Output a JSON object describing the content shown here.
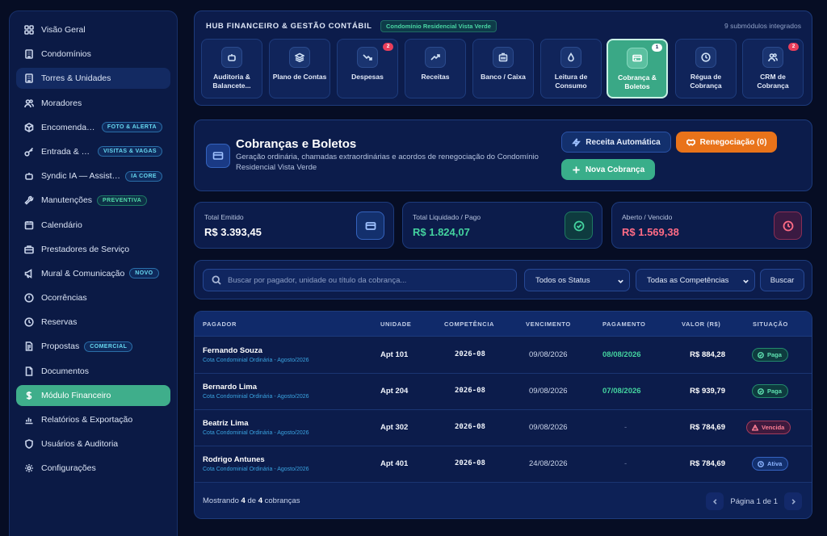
{
  "sidebar": {
    "items": [
      {
        "label": "Visão Geral",
        "icon": "grid-icon"
      },
      {
        "label": "Condomínios",
        "icon": "building-icon"
      },
      {
        "label": "Torres & Unidades",
        "icon": "building-icon"
      },
      {
        "label": "Moradores",
        "icon": "users-icon"
      },
      {
        "label": "Encomendas &...",
        "icon": "package-icon",
        "badge": "FOTO & ALERTA"
      },
      {
        "label": "Entrada & Gar...",
        "icon": "key-icon",
        "badge": "VISITAS & VAGAS"
      },
      {
        "label": "Syndic IA — Assistente",
        "icon": "bot-icon",
        "badge": "IA CORE"
      },
      {
        "label": "Manutenções",
        "icon": "wrench-icon",
        "badge": "PREVENTIVA"
      },
      {
        "label": "Calendário",
        "icon": "calendar-icon"
      },
      {
        "label": "Prestadores de Serviço",
        "icon": "briefcase-icon"
      },
      {
        "label": "Mural & Comunicação",
        "icon": "megaphone-icon",
        "badge": "NOVO"
      },
      {
        "label": "Ocorrências",
        "icon": "alert-circle-icon"
      },
      {
        "label": "Reservas",
        "icon": "clock-icon"
      },
      {
        "label": "Propostas",
        "icon": "document-icon",
        "badge": "COMERCIAL"
      },
      {
        "label": "Documentos",
        "icon": "file-icon"
      },
      {
        "label": "Módulo Financeiro",
        "icon": "dollar-icon"
      },
      {
        "label": "Relatórios & Exportação",
        "icon": "chart-icon"
      },
      {
        "label": "Usuários & Auditoria",
        "icon": "shield-icon"
      },
      {
        "label": "Configurações",
        "icon": "gear-icon"
      }
    ]
  },
  "hub": {
    "title": "HUB FINANCEIRO & GESTÃO CONTÁBIL",
    "condominium": "Condomínio Residencial Vista Verde",
    "count": "9 submódulos integrados",
    "modules": [
      {
        "label": "Auditoria & Balancete...",
        "icon": "robot-icon"
      },
      {
        "label": "Plano de Contas",
        "icon": "layers-icon"
      },
      {
        "label": "Despesas",
        "icon": "trending-down-icon",
        "badge": "2"
      },
      {
        "label": "Receitas",
        "icon": "trending-up-icon"
      },
      {
        "label": "Banco / Caixa",
        "icon": "bank-icon"
      },
      {
        "label": "Leitura de Consumo",
        "icon": "droplet-icon"
      },
      {
        "label": "Cobrança & Boletos",
        "icon": "credit-card-icon",
        "badge": "1"
      },
      {
        "label": "Régua de Cobrança",
        "icon": "clock-icon"
      },
      {
        "label": "CRM de Cobrança",
        "icon": "users-icon",
        "badge": "2"
      }
    ]
  },
  "cobranca": {
    "title": "Cobranças e Boletos",
    "description": "Geração ordinária, chamadas extraordinárias e acordos de renegociação do Condomínio Residencial Vista Verde",
    "btn_auto": "Receita Automática",
    "btn_reneg": "Renegociação (0)",
    "btn_nova": "Nova Cobrança"
  },
  "stats": [
    {
      "label": "Total Emitido",
      "value": "R$ 3.393,45",
      "color": "#ffffff"
    },
    {
      "label": "Total Liquidado / Pago",
      "value": "R$ 1.824,07",
      "color": "#44d39f"
    },
    {
      "label": "Aberto / Vencido",
      "value": "R$ 1.569,38",
      "color": "#ff6b85"
    }
  ],
  "filters": {
    "search_placeholder": "Buscar por pagador, unidade ou título da cobrança...",
    "status": "Todos os Status",
    "competencia": "Todas as Competências",
    "buscar": "Buscar"
  },
  "table": {
    "headers": [
      "PAGADOR",
      "UNIDADE",
      "COMPETÊNCIA",
      "VENCIMENTO",
      "PAGAMENTO",
      "VALOR (R$)",
      "SITUAÇÃO"
    ],
    "rows": [
      {
        "name": "Fernando Souza",
        "sub": "Cota Condominial Ordinária - Agosto/2026",
        "unit": "Apt 101",
        "comp": "2026-08",
        "venc": "09/08/2026",
        "pag": "08/08/2026",
        "val": "R$ 884,28",
        "status": "Paga"
      },
      {
        "name": "Bernardo Lima",
        "sub": "Cota Condominial Ordinária - Agosto/2026",
        "unit": "Apt 204",
        "comp": "2026-08",
        "venc": "09/08/2026",
        "pag": "07/08/2026",
        "val": "R$ 939,79",
        "status": "Paga"
      },
      {
        "name": "Beatriz Lima",
        "sub": "Cota Condominial Ordinária - Agosto/2026",
        "unit": "Apt 302",
        "comp": "2026-08",
        "venc": "09/08/2026",
        "pag": "-",
        "val": "R$ 784,69",
        "status": "Vencida"
      },
      {
        "name": "Rodrigo Antunes",
        "sub": "Cota Condominial Ordinária - Agosto/2026",
        "unit": "Apt 401",
        "comp": "2026-08",
        "venc": "24/08/2026",
        "pag": "-",
        "val": "R$ 784,69",
        "status": "Ativa"
      }
    ]
  },
  "footer": {
    "prefix": "Mostrando",
    "shown": "4",
    "of": "de",
    "total": "4",
    "suffix": "cobranças",
    "page": "Página 1 de 1"
  }
}
